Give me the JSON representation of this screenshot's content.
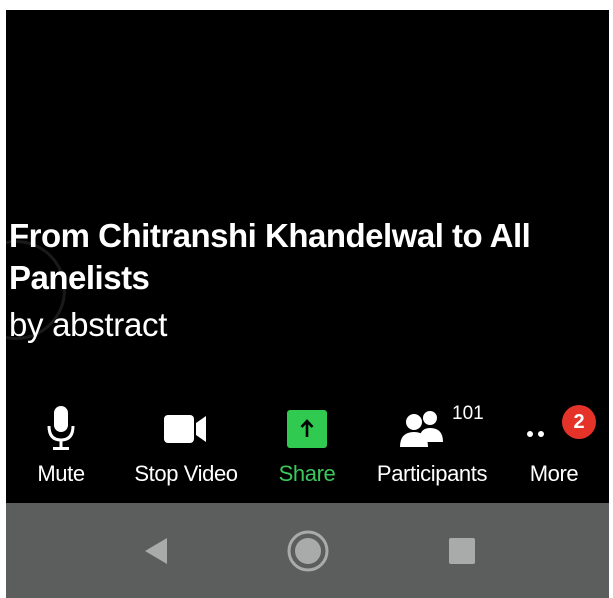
{
  "chat": {
    "header": "From Chitranshi Khandelwal to All Panelists",
    "message": "by abstract"
  },
  "toolbar": {
    "mute_label": "Mute",
    "stop_video_label": "Stop Video",
    "share_label": "Share",
    "participants_label": "Participants",
    "participants_count": "101",
    "more_label": "More",
    "more_badge": "2"
  },
  "colors": {
    "background": "#000000",
    "share_green": "#2fca4f",
    "badge_red": "#e5332a",
    "navbar_gray": "#5c5e5d"
  },
  "icons": {
    "mute": "microphone-icon",
    "stop_video": "video-camera-icon",
    "share": "share-up-arrow-icon",
    "participants": "participants-icon",
    "more": "more-dots-icon",
    "nav_back": "back-triangle-icon",
    "nav_home": "home-circle-icon",
    "nav_recents": "recents-square-icon"
  }
}
